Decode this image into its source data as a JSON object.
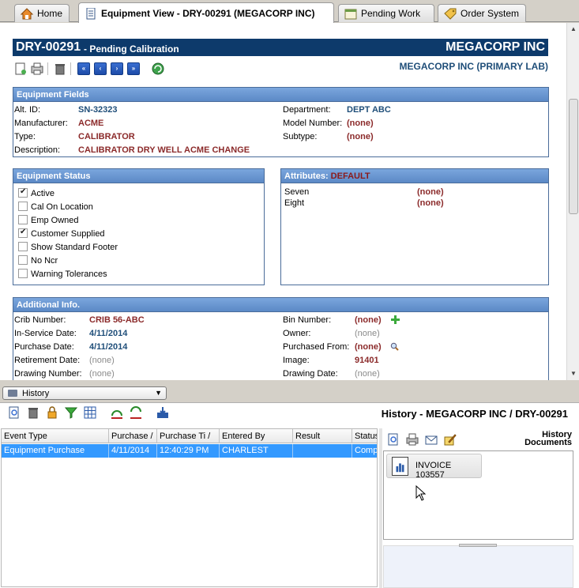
{
  "tabs": [
    {
      "label": "Home"
    },
    {
      "label": "Equipment View - DRY-00291 (MEGACORP INC)"
    },
    {
      "label": "Pending Work"
    },
    {
      "label": "Order System"
    }
  ],
  "header": {
    "id": "DRY-00291",
    "status": "- Pending Calibration",
    "company": "MEGACORP INC",
    "lab": "MEGACORP INC (PRIMARY LAB)"
  },
  "equipment_fields": {
    "title": "Equipment Fields",
    "alt_id_label": "Alt. ID:",
    "alt_id": "SN-32323",
    "manufacturer_label": "Manufacturer:",
    "manufacturer": "ACME",
    "type_label": "Type:",
    "type": "CALIBRATOR",
    "description_label": "Description:",
    "description": "CALIBRATOR DRY WELL ACME CHANGE",
    "department_label": "Department:",
    "department": "DEPT ABC",
    "model_label": "Model Number:",
    "model": "(none)",
    "subtype_label": "Subtype:",
    "subtype": "(none)"
  },
  "equipment_status": {
    "title": "Equipment Status",
    "items": [
      {
        "label": "Active",
        "checked": true
      },
      {
        "label": "Cal On Location",
        "checked": false
      },
      {
        "label": "Emp Owned",
        "checked": false
      },
      {
        "label": "Customer Supplied",
        "checked": true
      },
      {
        "label": "Show Standard Footer",
        "checked": false
      },
      {
        "label": "No Ncr",
        "checked": false
      },
      {
        "label": "Warning Tolerances",
        "checked": false
      }
    ]
  },
  "attributes": {
    "title": "Attributes:",
    "set": "DEFAULT",
    "items": [
      {
        "label": "Seven",
        "value": "(none)"
      },
      {
        "label": "Eight",
        "value": "(none)"
      }
    ]
  },
  "additional_info": {
    "title": "Additional Info.",
    "crib_label": "Crib Number:",
    "crib": "CRIB 56-ABC",
    "inservice_label": "In-Service Date:",
    "inservice": "4/11/2014",
    "purchase_label": "Purchase Date:",
    "purchase": "4/11/2014",
    "retirement_label": "Retirement Date:",
    "retirement": "(none)",
    "drawing_label": "Drawing Number:",
    "drawing": "(none)",
    "bin_label": "Bin Number:",
    "bin": "(none)",
    "owner_label": "Owner:",
    "owner": "(none)",
    "purchased_from_label": "Purchased From:",
    "purchased_from": "(none)",
    "image_label": "Image:",
    "image": "91401",
    "drawing_date_label": "Drawing Date:",
    "drawing_date": "(none)"
  },
  "history": {
    "selector": "History",
    "title": "History - MEGACORP INC / DRY-00291",
    "columns": [
      "Event Type",
      "Purchase /",
      "Purchase Ti /",
      "Entered By",
      "Result",
      "Status"
    ],
    "rows": [
      [
        "Equipment Purchase",
        "4/11/2014",
        "12:40:29 PM",
        "CHARLEST",
        "",
        "Compl"
      ]
    ]
  },
  "documents": {
    "title_line1": "History",
    "title_line2": "Documents",
    "items": [
      {
        "label": "INVOICE 103557"
      }
    ]
  }
}
